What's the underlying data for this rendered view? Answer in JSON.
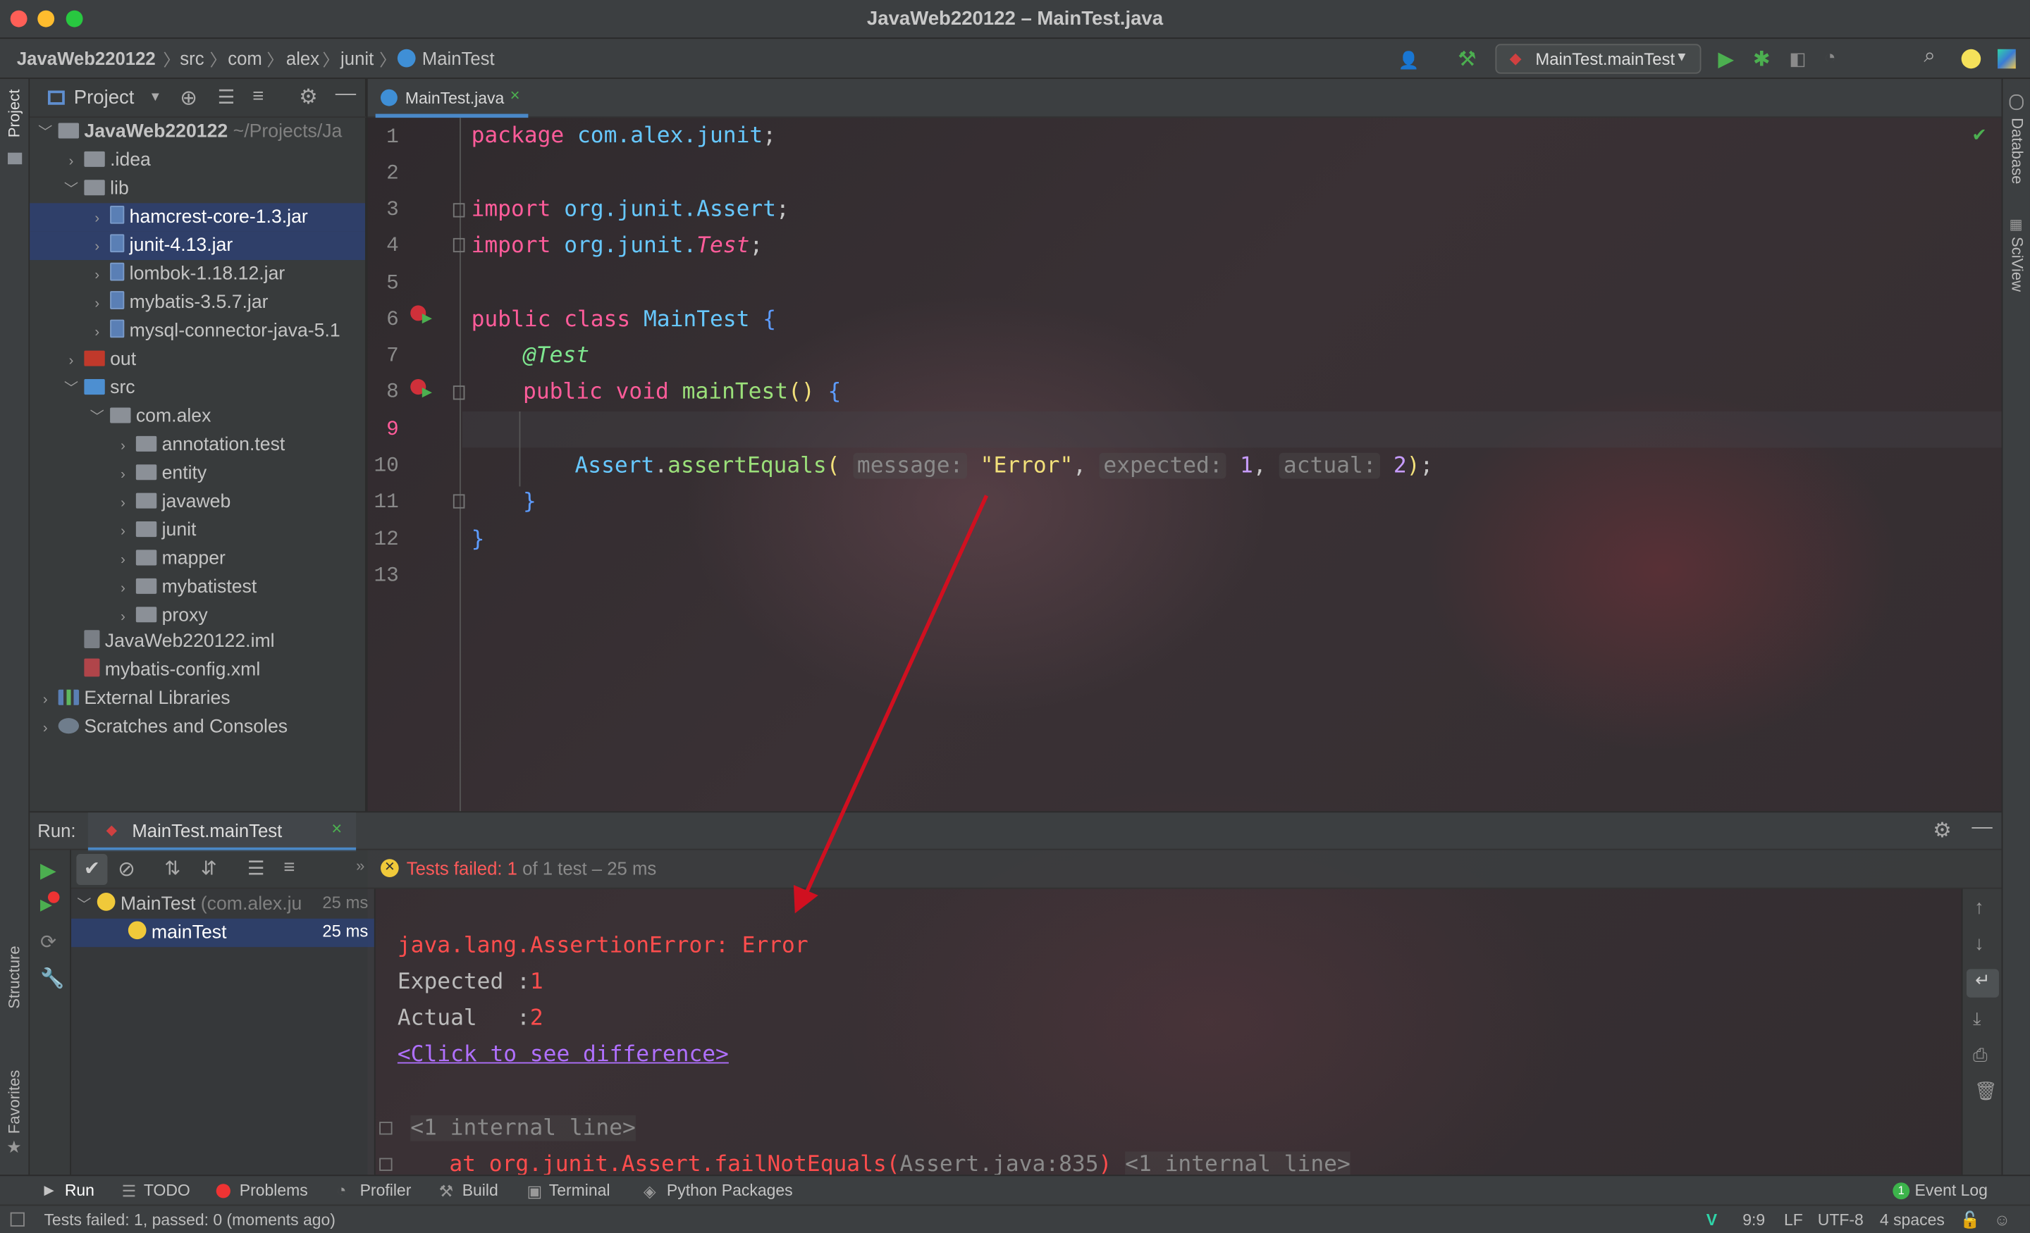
{
  "window": {
    "title": "JavaWeb220122 – MainTest.java"
  },
  "navbar": {
    "crumbs": [
      "JavaWeb220122",
      "src",
      "com",
      "alex",
      "junit",
      "MainTest"
    ],
    "run_config": "MainTest.mainTest"
  },
  "project_panel": {
    "title": "Project",
    "root": {
      "name": "JavaWeb220122",
      "path": "~/Projects/Ja"
    },
    "items": [
      ".idea",
      "lib",
      "hamcrest-core-1.3.jar",
      "junit-4.13.jar",
      "lombok-1.18.12.jar",
      "mybatis-3.5.7.jar",
      "mysql-connector-java-5.1",
      "out",
      "src",
      "com.alex",
      "annotation.test",
      "entity",
      "javaweb",
      "junit",
      "mapper",
      "mybatistest",
      "proxy",
      "JavaWeb220122.iml",
      "mybatis-config.xml",
      "External Libraries",
      "Scratches and Consoles"
    ]
  },
  "left_strip": {
    "project": "Project",
    "structure": "Structure",
    "favorites": "Favorites"
  },
  "right_strip": {
    "database": "Database",
    "sciview": "SciView"
  },
  "editor": {
    "tab": "MainTest.java",
    "line_numbers": [
      "1",
      "2",
      "3",
      "4",
      "5",
      "6",
      "7",
      "8",
      "9",
      "10",
      "11",
      "12",
      "13"
    ],
    "code": {
      "l1_kw": "package",
      "l1_pk": "com.alex.junit",
      "l3_kw": "import",
      "l3_pk": "org.junit.Assert",
      "l4_kw": "import",
      "l4_pk": "org.junit.",
      "l4_cls": "Test",
      "l6_kw": "public class",
      "l6_cls": "MainTest",
      "l7_ann": "@Test",
      "l8_kw": "public void",
      "l8_fn": "mainTest",
      "l10_cls": "Assert",
      "l10_fn": "assertEquals",
      "hint_message": "message:",
      "str_error": "\"Error\"",
      "hint_expected": "expected:",
      "num_expected": "1",
      "hint_actual": "actual:",
      "num_actual": "2"
    }
  },
  "run": {
    "label": "Run:",
    "tab": "MainTest.mainTest",
    "status_prefix": "Tests failed:",
    "status_count": "1",
    "status_suffix": "of 1 test – 25 ms",
    "tree": [
      {
        "name": "MainTest",
        "pkg": "(com.alex.ju",
        "time": "25 ms"
      },
      {
        "name": "mainTest",
        "time": "25 ms"
      }
    ],
    "console": {
      "error": "java.lang.AssertionError: Error",
      "expected_label": "Expected :",
      "expected_value": "1",
      "actual_label": "Actual   :",
      "actual_value": "2",
      "diff_link": "<Click to see difference>",
      "internal1": "<1 internal line>",
      "at_line": "at org.junit.Assert.failNotEquals(",
      "at_src": "Assert.java:835",
      "internal2": "<1 internal line>"
    }
  },
  "tool_windows": [
    "Run",
    "TODO",
    "Problems",
    "Profiler",
    "Build",
    "Terminal",
    "Python Packages"
  ],
  "event_log": {
    "label": "Event Log",
    "count": "1"
  },
  "status_bar": {
    "message": "Tests failed: 1, passed: 0 (moments ago)",
    "position": "9:9",
    "line_sep": "LF",
    "encoding": "UTF-8",
    "indent": "4 spaces"
  },
  "colors": {
    "accent": "#4a88c7",
    "error": "#ff4d4d",
    "run_green": "#4caf50",
    "keyword": "#ff5c9a",
    "type": "#67c8ff",
    "string": "#f2e07a",
    "number": "#c79cff",
    "annotation": "#7ee68f",
    "arrow": "#d01020"
  }
}
